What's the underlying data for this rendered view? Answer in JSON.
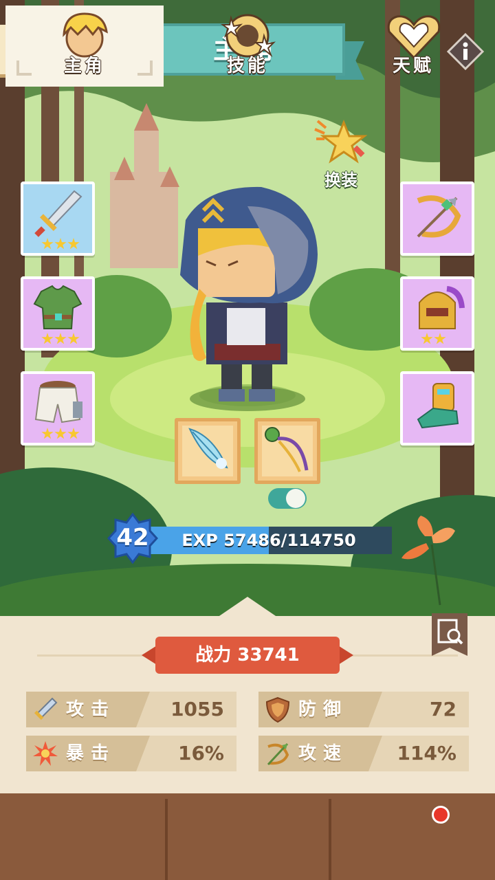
{
  "header": {
    "title": "主角"
  },
  "actions": {
    "change_outfit_label": "换装"
  },
  "slots_left": [
    {
      "item": "sword",
      "stars": 3,
      "rarity": "blue"
    },
    {
      "item": "green-armor",
      "stars": 3,
      "rarity": "purple"
    },
    {
      "item": "pants",
      "stars": 3,
      "rarity": "purple"
    }
  ],
  "slots_right": [
    {
      "item": "crossbow",
      "stars": 0,
      "rarity": "purple"
    },
    {
      "item": "helmet",
      "stars": 2,
      "rarity": "purple"
    },
    {
      "item": "boots",
      "stars": 0,
      "rarity": "purple"
    }
  ],
  "skill_slots": [
    {
      "item": "feather-blade"
    },
    {
      "item": "bow-staff"
    }
  ],
  "level": {
    "value": "42",
    "exp_text": "EXP 57486/114750",
    "exp_current": 57486,
    "exp_max": 114750
  },
  "stats_panel": {
    "power": "战力 33741",
    "stats": [
      {
        "name": "攻击",
        "value": "1055",
        "icon": "sword-icon"
      },
      {
        "name": "防御",
        "value": "72",
        "icon": "shield-icon"
      },
      {
        "name": "暴击",
        "value": "16%",
        "icon": "crit-burst-icon"
      },
      {
        "name": "攻速",
        "value": "114%",
        "icon": "bow-icon"
      }
    ]
  },
  "nav": {
    "tabs": [
      {
        "label": "主角",
        "icon": "hero-icon",
        "active": true
      },
      {
        "label": "技能",
        "icon": "skill-icon",
        "active": false
      },
      {
        "label": "天赋",
        "icon": "talent-icon",
        "active": false,
        "badge": true
      }
    ]
  },
  "colors": {
    "teal": "#6cc5bd",
    "power_red": "#df5a3e",
    "exp_blue": "#4aa3e8",
    "panel": "#f1e5d0",
    "nav": "#8a5a3c"
  }
}
